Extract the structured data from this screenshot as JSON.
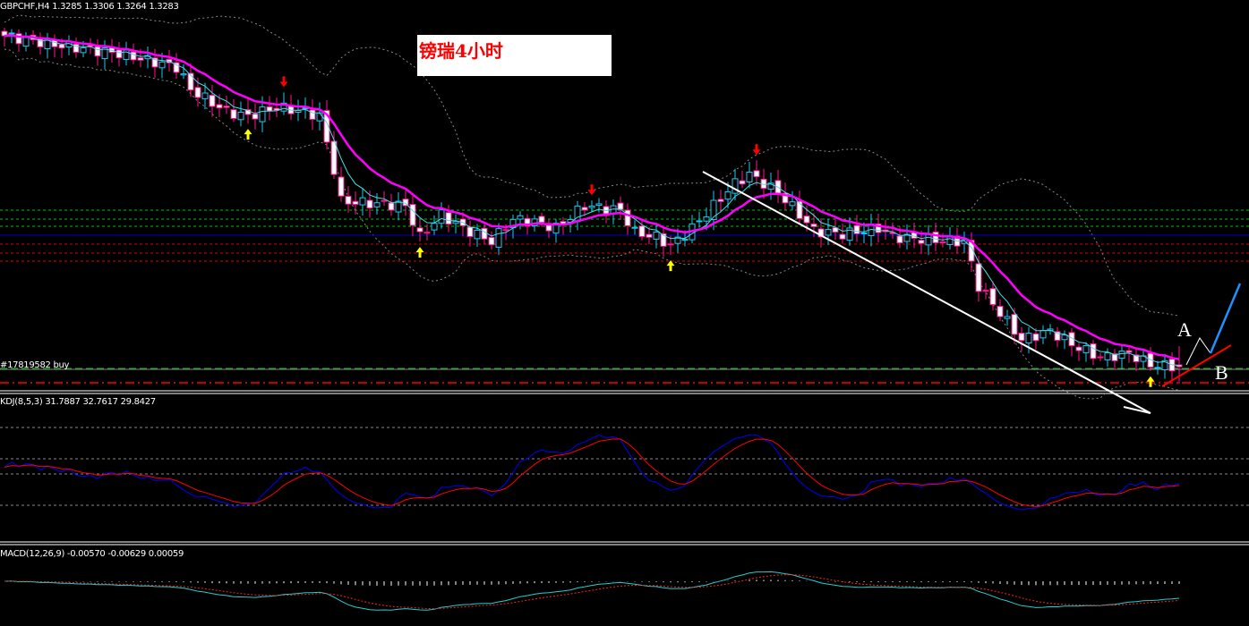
{
  "header": {
    "symbol_line": "GBPCHF,H4  1.3285 1.3306 1.3264 1.3283"
  },
  "title_box": {
    "text": "镑瑞4小时"
  },
  "order_label": "#17819582 buy",
  "kdj_label": "KDJ(8,5,3) 31.7887 32.7617 29.8427",
  "macd_label": "MACD(12,26,9) -0.00570 -0.00629 0.00059",
  "annotations": {
    "a": "A",
    "b": "B"
  },
  "colors": {
    "bull": "#1ec8f0",
    "bear_fill": "#ffffff",
    "bear_edge": "#ff1493",
    "ma_slow": "#ff00ff",
    "ma_fast": "#40e0e0",
    "bands": "#888888",
    "kdj_k": "#0000ff",
    "kdj_d": "#ff0000",
    "macd_hist": "#ffffff",
    "macd_line": "#20d0d0",
    "signal": "#ff2020",
    "up_arrow": "#ffff00",
    "down_arrow": "#ff0000"
  },
  "chart_data": {
    "type": "candlestick",
    "symbol": "GBPCHF",
    "timeframe": "H4",
    "last_ohlc": {
      "open": 1.3285,
      "high": 1.3306,
      "low": 1.3264,
      "close": 1.3283
    },
    "close_waypoints": [
      [
        0,
        1.3653
      ],
      [
        7,
        1.3643
      ],
      [
        16,
        1.3633
      ],
      [
        24,
        1.3618
      ],
      [
        26,
        1.3593
      ],
      [
        31,
        1.3568
      ],
      [
        34,
        1.3563
      ],
      [
        38,
        1.3573
      ],
      [
        42,
        1.3568
      ],
      [
        44,
        1.3563
      ],
      [
        46,
        1.3503
      ],
      [
        47,
        1.3468
      ],
      [
        52,
        1.3465
      ],
      [
        56,
        1.3463
      ],
      [
        58,
        1.3428
      ],
      [
        61,
        1.3453
      ],
      [
        64,
        1.3438
      ],
      [
        68,
        1.3423
      ],
      [
        71,
        1.3448
      ],
      [
        74,
        1.3445
      ],
      [
        77,
        1.3438
      ],
      [
        81,
        1.3463
      ],
      [
        86,
        1.3458
      ],
      [
        88,
        1.3433
      ],
      [
        91,
        1.3428
      ],
      [
        93,
        1.3418
      ],
      [
        96,
        1.3438
      ],
      [
        99,
        1.3463
      ],
      [
        102,
        1.3488
      ],
      [
        104,
        1.3498
      ],
      [
        108,
        1.3478
      ],
      [
        111,
        1.3453
      ],
      [
        113,
        1.3435
      ],
      [
        117,
        1.3431
      ],
      [
        122,
        1.3438
      ],
      [
        124,
        1.3428
      ],
      [
        129,
        1.3425
      ],
      [
        134,
        1.3423
      ],
      [
        136,
        1.3373
      ],
      [
        138,
        1.3353
      ],
      [
        142,
        1.3313
      ],
      [
        146,
        1.3323
      ],
      [
        149,
        1.3308
      ],
      [
        153,
        1.3293
      ],
      [
        157,
        1.3298
      ],
      [
        160,
        1.3285
      ],
      [
        164,
        1.3283
      ]
    ],
    "horizontal_levels": {
      "green_dashed": [
        1.3458,
        1.3448,
        1.344
      ],
      "red_dashed": [
        1.342,
        1.341,
        1.3401
      ],
      "blue_solid": 1.343,
      "buy_order": 1.328,
      "stop_red": 1.3265
    },
    "sell_arrow_bars": [
      39,
      82,
      105
    ],
    "buy_arrow_bars": [
      34,
      58,
      93,
      160
    ],
    "indicators": [
      "EMA fast",
      "EMA slow",
      "Bollinger Bands",
      "KDJ(8,5,3)",
      "MACD(12,26,9)"
    ]
  }
}
